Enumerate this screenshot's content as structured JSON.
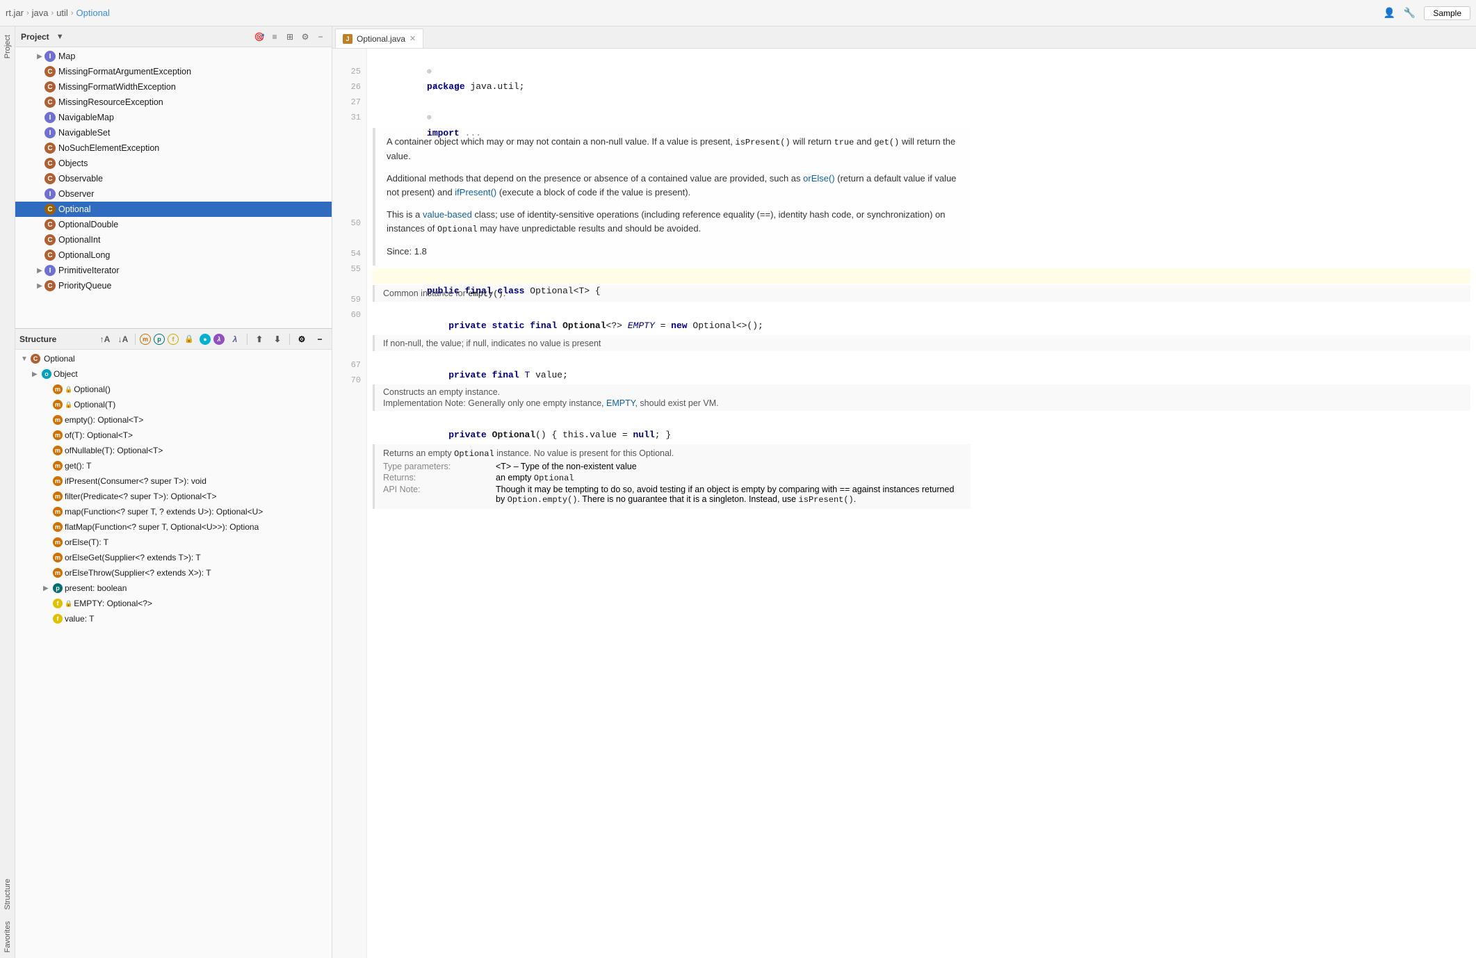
{
  "topbar": {
    "breadcrumb": [
      "rt.jar",
      "java",
      "util",
      "Optional"
    ],
    "separators": [
      ">",
      ">",
      ">"
    ],
    "sample_btn": "Sample"
  },
  "project_panel": {
    "title": "Project",
    "tree_items": [
      {
        "label": "Map",
        "icon": "i",
        "indent": 2,
        "expanded": false
      },
      {
        "label": "MissingFormatArgumentException",
        "icon": "c",
        "indent": 2
      },
      {
        "label": "MissingFormatWidthException",
        "icon": "c",
        "indent": 2
      },
      {
        "label": "MissingResourceException",
        "icon": "c",
        "indent": 2
      },
      {
        "label": "NavigableMap",
        "icon": "i",
        "indent": 2
      },
      {
        "label": "NavigableSet",
        "icon": "i",
        "indent": 2
      },
      {
        "label": "NoSuchElementException",
        "icon": "c",
        "indent": 2
      },
      {
        "label": "Objects",
        "icon": "c",
        "indent": 2
      },
      {
        "label": "Observable",
        "icon": "c",
        "indent": 2
      },
      {
        "label": "Observer",
        "icon": "i",
        "indent": 2
      },
      {
        "label": "Optional",
        "icon": "c",
        "indent": 2,
        "selected": true
      },
      {
        "label": "OptionalDouble",
        "icon": "c",
        "indent": 2
      },
      {
        "label": "OptionalInt",
        "icon": "c",
        "indent": 2
      },
      {
        "label": "OptionalLong",
        "icon": "c",
        "indent": 2
      },
      {
        "label": "PrimitiveIterator",
        "icon": "i",
        "indent": 2,
        "expandable": true
      },
      {
        "label": "PriorityQueue",
        "icon": "c",
        "indent": 2,
        "expandable": true
      }
    ]
  },
  "structure_panel": {
    "title": "Structure",
    "items": [
      {
        "label": "Optional",
        "type": "c",
        "indent": 0,
        "expanded": true,
        "lock": false
      },
      {
        "label": "Object",
        "type": "o",
        "indent": 1,
        "expanded": false,
        "lock": false
      },
      {
        "label": "Optional()",
        "type": "m",
        "indent": 1,
        "lock": true
      },
      {
        "label": "Optional(T)",
        "type": "m",
        "indent": 1,
        "lock": true
      },
      {
        "label": "empty(): Optional<T>",
        "type": "m",
        "indent": 1,
        "lock": false
      },
      {
        "label": "of(T): Optional<T>",
        "type": "m",
        "indent": 1,
        "lock": false
      },
      {
        "label": "ofNullable(T): Optional<T>",
        "type": "m",
        "indent": 1,
        "lock": false
      },
      {
        "label": "get(): T",
        "type": "m",
        "indent": 1,
        "lock": false
      },
      {
        "label": "ifPresent(Consumer<? super T>): void",
        "type": "m",
        "indent": 1,
        "lock": false
      },
      {
        "label": "filter(Predicate<? super T>): Optional<T>",
        "type": "m",
        "indent": 1,
        "lock": false
      },
      {
        "label": "map(Function<? super T, ? extends U>): Optional<U>",
        "type": "m",
        "indent": 1,
        "lock": false
      },
      {
        "label": "flatMap(Function<? super T, Optional<U>>): Optiona",
        "type": "m",
        "indent": 1,
        "lock": false
      },
      {
        "label": "orElse(T): T",
        "type": "m",
        "indent": 1,
        "lock": false
      },
      {
        "label": "orElseGet(Supplier<? extends T>): T",
        "type": "m",
        "indent": 1,
        "lock": false
      },
      {
        "label": "orElseThrow(Supplier<? extends X>): T",
        "type": "m",
        "indent": 1,
        "lock": false
      },
      {
        "label": "present: boolean",
        "type": "p",
        "indent": 1,
        "expandable": true
      },
      {
        "label": "EMPTY: Optional<?>",
        "type": "f",
        "indent": 1,
        "lock": true
      },
      {
        "label": "value: T",
        "type": "f",
        "indent": 1,
        "lock": false
      }
    ]
  },
  "editor": {
    "tab_label": "Optional.java",
    "lines": [
      {
        "num": "",
        "content": "/.../",
        "type": "fold"
      },
      {
        "num": "25",
        "content": "package java.util;",
        "type": "code"
      },
      {
        "num": "26",
        "content": "",
        "type": "empty"
      },
      {
        "num": "27",
        "content": "import ...",
        "type": "code",
        "fold": true
      },
      {
        "num": "31",
        "content": "",
        "type": "empty"
      },
      {
        "num": "",
        "content": "doc:A container object which may or may not contain a non-null value. If a value is present, isPresent() will return true and get() will return the value.",
        "type": "doc"
      },
      {
        "num": "",
        "content": "doc2:Additional methods that depend on the presence or absence of a contained value are provided, such as orElse() (return a default value if value not present) and ifPresent() (execute a block of code if the value is present).",
        "type": "doc"
      },
      {
        "num": "",
        "content": "doc3:This is a value-based class; use of identity-sensitive operations (including reference equality (==), identity hash code, or synchronization) on instances of Optional may have unpredictable results and should be avoided.",
        "type": "doc"
      },
      {
        "num": "",
        "content": "doc4:Since: 1.8",
        "type": "doc"
      },
      {
        "num": "50",
        "content": "public final class Optional<T> {",
        "type": "code",
        "highlighted": true
      },
      {
        "num": "",
        "content": "doccomment:Common instance for empty().",
        "type": "doccomment"
      },
      {
        "num": "54",
        "content": "    private static final Optional<?> EMPTY = new Optional<>();",
        "type": "code"
      },
      {
        "num": "55",
        "content": "",
        "type": "empty"
      },
      {
        "num": "",
        "content": "doccomment2:If non-null, the value; if null, indicates no value is present",
        "type": "doccomment"
      },
      {
        "num": "59",
        "content": "    private final T value;",
        "type": "code"
      },
      {
        "num": "60",
        "content": "",
        "type": "empty"
      },
      {
        "num": "",
        "content": "doccomment3:Constructs an empty instance.\nImplementation Note: Generally only one empty instance, EMPTY, should exist per VM.",
        "type": "doccomment"
      },
      {
        "num": "67",
        "content": "    private Optional() { this.value = null; }",
        "type": "code"
      },
      {
        "num": "70",
        "content": "",
        "type": "empty"
      },
      {
        "num": "",
        "content": "doccomment4:Returns an empty Optional instance. No value is present for this Optional.\nType parameters: <T> – Type of the non-existent value\nReturns: an empty Optional\nAPI Note: Though it may be tempting to do so, avoid testing if an object is empty by comparing with == against instances returned by Option.empty(). There is no guarantee that it is a singleton. Instead, use isPresent().",
        "type": "doccomment"
      }
    ]
  }
}
